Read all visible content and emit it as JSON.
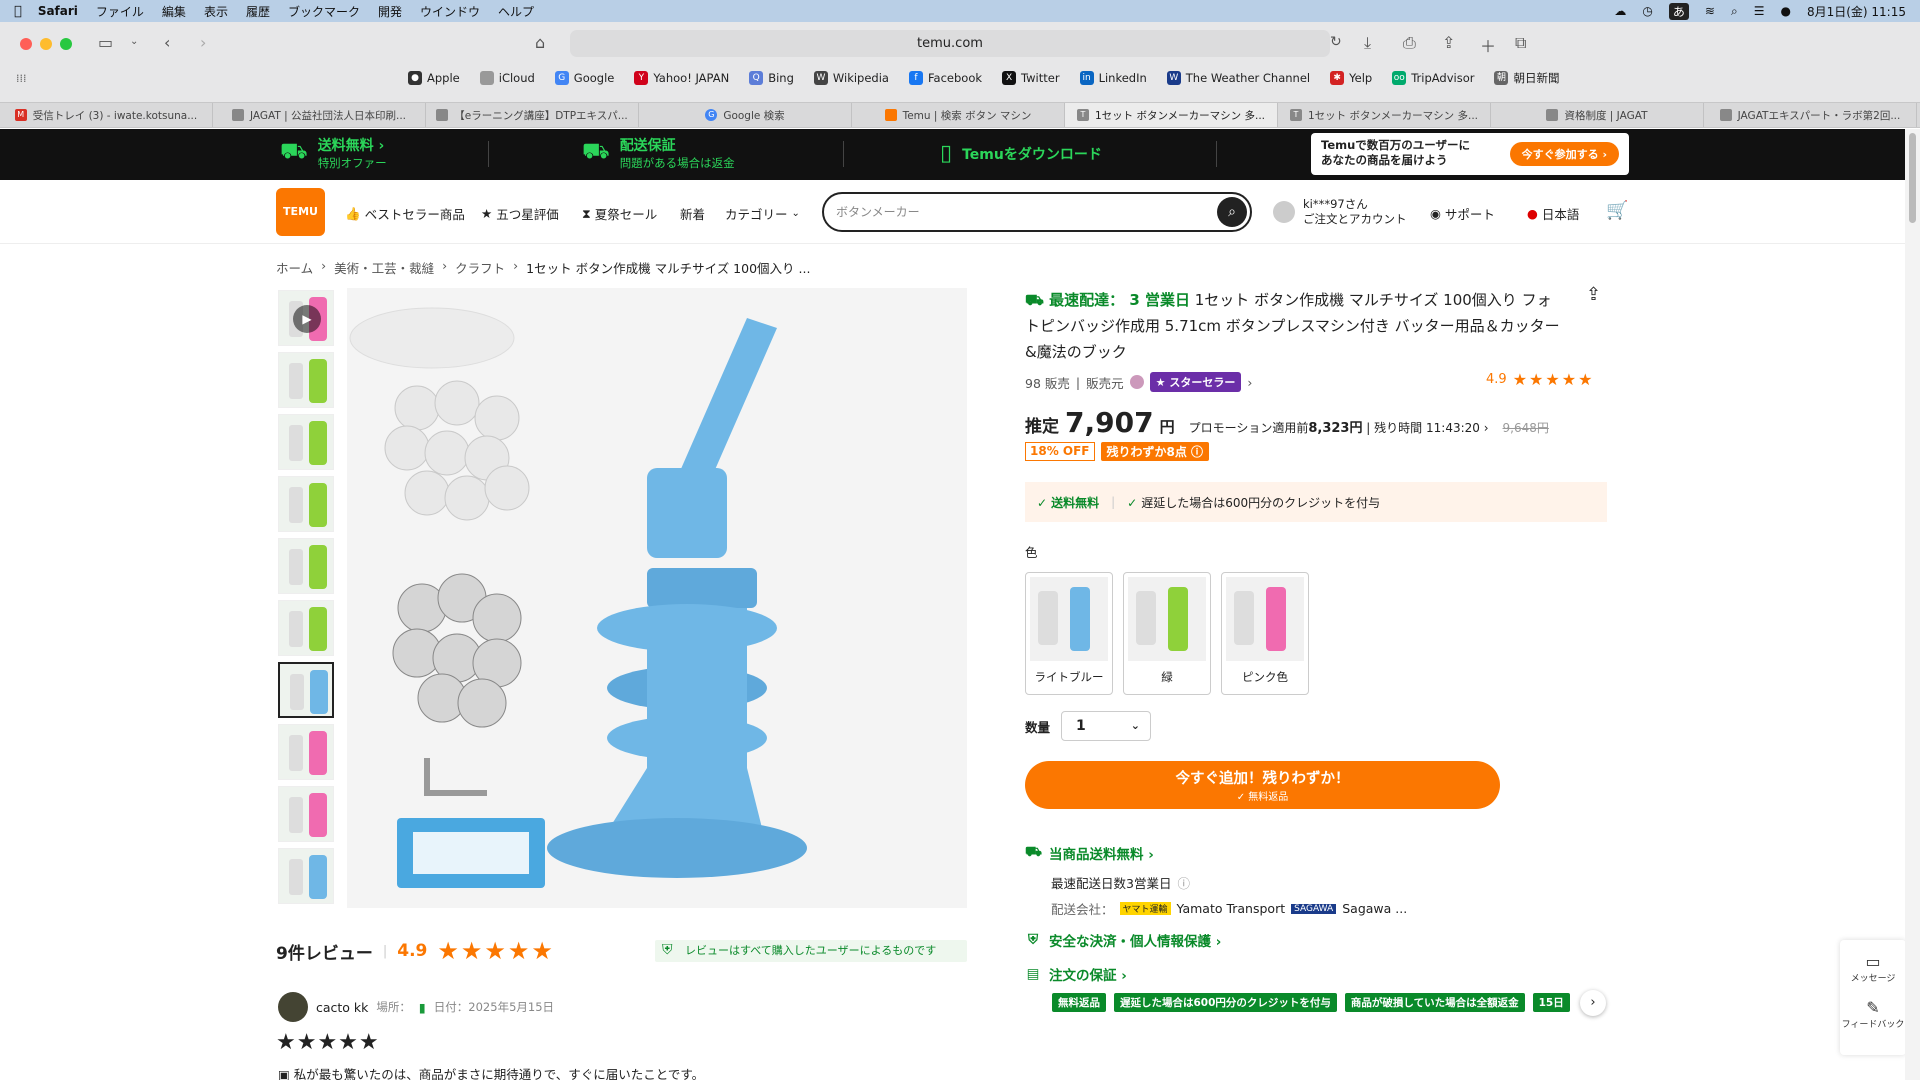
{
  "macbar": {
    "app": "Safari",
    "menus": [
      "ファイル",
      "編集",
      "表示",
      "履歴",
      "ブックマーク",
      "開発",
      "ウインドウ",
      "ヘルプ"
    ],
    "datetime": "8月1日(金)  11:15",
    "ime": "あ"
  },
  "browser": {
    "url": "temu.com",
    "favorites": [
      "Apple",
      "iCloud",
      "Google",
      "Yahoo! JAPAN",
      "Bing",
      "Wikipedia",
      "Facebook",
      "Twitter",
      "LinkedIn",
      "The Weather Channel",
      "Yelp",
      "TripAdvisor",
      "朝日新聞"
    ],
    "tabs": [
      "受信トレイ (3) - iwate.kotsuna...",
      "JAGAT | 公益社団法人日本印刷...",
      "【eラーニング講座】DTPエキスパ...",
      "Google 検索",
      "Temu | 検索 ボタン マシン",
      "1セット ボタンメーカーマシン 多...",
      "1セット ボタンメーカーマシン 多...",
      "資格制度 | JAGAT",
      "JAGATエキスパート・ラボ第2回..."
    ]
  },
  "promo": {
    "free_ship_title": "送料無料 ›",
    "free_ship_sub": "特別オファー",
    "guarantee_title": "配送保証",
    "guarantee_sub": "問題がある場合は返金",
    "download": "Temuをダウンロード",
    "banner_text_1": "Temuで数百万のユーザーに",
    "banner_text_2": "あなたの商品を届けよう",
    "banner_btn": "今すぐ参加する ›"
  },
  "header": {
    "logo": "TEMU",
    "nav": [
      "ベストセラー商品",
      "五つ星評価",
      "夏祭セール",
      "新着",
      "カテゴリー"
    ],
    "search_placeholder": "ボタンメーカー",
    "account_1": "ki***97さん",
    "account_2": "ご注文とアカウント",
    "support": "サポート",
    "language": "日本語"
  },
  "breadcrumb": [
    "ホーム",
    "美術・工芸・裁縫",
    "クラフト",
    "1セット ボタン作成機 マルチサイズ 100個入り ..."
  ],
  "product": {
    "fast_label": "最速配達： 3 営業日",
    "title": "1セット ボタン作成機 マルチサイズ 100個入り フォトピンバッジ作成用 5.71cm ボタンプレスマシン付き バッター用品＆カッター&魔法のブック",
    "sold": "98 販売",
    "seller_label": "販売元",
    "star_seller": "スターセラー",
    "rating": "4.9",
    "price_label": "推定",
    "price": "7,907",
    "price_unit": "円",
    "promo_before": "プロモーション適用前",
    "promo_price": "8,323円",
    "remaining_label": "残り時間",
    "remaining_time": "11:43:20",
    "orig_price": "9,648円",
    "discount": "18% OFF",
    "few_left": "残りわずか8点",
    "ship_free": "送料無料",
    "late_credit": "遅延した場合は600円分のクレジットを付与",
    "color_label": "色",
    "colors": [
      {
        "label": "ライトブルー",
        "hex": "#6fb7e6"
      },
      {
        "label": "緑",
        "hex": "#8fd13a"
      },
      {
        "label": "ピンク色",
        "hex": "#f06bb0"
      }
    ],
    "qty_label": "数量",
    "qty": "1",
    "cart_btn": "今すぐ追加！残りわずか！",
    "cart_sub": "✓ 無料返品",
    "ship_info": "当商品送料無料 ›",
    "ship_days": "最速配送日数3営業日",
    "carrier_label": "配送会社：",
    "carrier_1": "Yamato Transport",
    "carrier_2": "Sagawa ...",
    "security": "安全な決済・個人情報保護 ›",
    "order_guarantee": "注文の保証 ›",
    "guarantee_tags": [
      "無料返品",
      "遅延した場合は600円分のクレジットを付与",
      "商品が破損していた場合は全額返金",
      "15日"
    ]
  },
  "reviews": {
    "count": "9件レビュー",
    "rating": "4.9",
    "verified": "レビューはすべて購入したユーザーによるものです",
    "reviewer": "cacto kk",
    "location_label": "場所：",
    "date": "日付：2025年5月15日",
    "text": "私が最も驚いたのは、商品がまさに期待通りで、すぐに届いたことです。"
  },
  "side": {
    "message": "メッセージ",
    "feedback": "フィードバック"
  },
  "thumb_colors": [
    "#f06bb0",
    "#8fd13a",
    "#8fd13a",
    "#8fd13a",
    "#8fd13a",
    "#8fd13a",
    "#6fb7e6",
    "#f06bb0",
    "#f06bb0",
    "#6fb7e6"
  ]
}
